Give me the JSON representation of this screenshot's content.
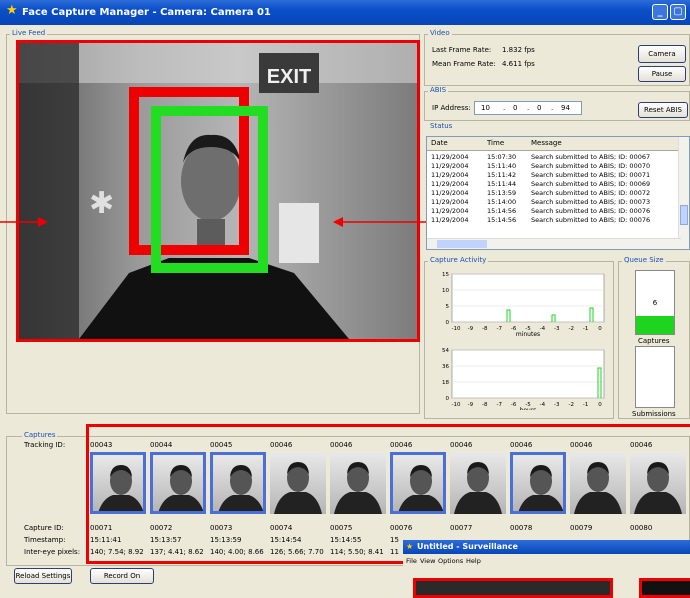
{
  "window": {
    "title": "Face Capture Manager - Camera: Camera 01"
  },
  "live_feed": {
    "legend": "Live Feed",
    "exit_sign": "EXIT"
  },
  "video": {
    "legend": "Video",
    "last_frame_rate_label": "Last Frame Rate:",
    "last_frame_rate_value": "1.832 fps",
    "mean_frame_rate_label": "Mean Frame Rate:",
    "mean_frame_rate_value": "4.611 fps",
    "camera_button": "Camera",
    "pause_button": "Pause"
  },
  "abis": {
    "legend": "ABIS",
    "ip_label": "IP Address:",
    "ip_octets": [
      "10",
      "0",
      "0",
      "94"
    ],
    "reset_button": "Reset ABIS"
  },
  "status": {
    "legend": "Status",
    "columns": [
      "Date",
      "Time",
      "Message"
    ],
    "rows": [
      [
        "11/29/2004",
        "15:07:30",
        "Search submitted to ABIS; ID: 00067"
      ],
      [
        "11/29/2004",
        "15:11:40",
        "Search submitted to ABIS; ID: 00070"
      ],
      [
        "11/29/2004",
        "15:11:42",
        "Search submitted to ABIS; ID: 00071"
      ],
      [
        "11/29/2004",
        "15:11:44",
        "Search submitted to ABIS; ID: 00069"
      ],
      [
        "11/29/2004",
        "15:13:59",
        "Search submitted to ABIS; ID: 00072"
      ],
      [
        "11/29/2004",
        "15:14:00",
        "Search submitted to ABIS; ID: 00073"
      ],
      [
        "11/29/2004",
        "15:14:56",
        "Search submitted to ABIS; ID: 00076"
      ],
      [
        "11/29/2004",
        "15:14:56",
        "Search submitted to ABIS; ID: 00076"
      ]
    ]
  },
  "capture_activity": {
    "legend": "Capture Activity",
    "minutes_chart": {
      "y_ticks": [
        "15",
        "10",
        "5",
        "0"
      ],
      "x_ticks": [
        "-10",
        "-9",
        "-8",
        "-7",
        "-6",
        "-5",
        "-4",
        "-3",
        "-2",
        "-1",
        "0"
      ],
      "xlabel": "minutes"
    },
    "hours_chart": {
      "y_ticks": [
        "54",
        "36",
        "18",
        "0"
      ],
      "x_ticks": [
        "-10",
        "-9",
        "-8",
        "-7",
        "-6",
        "-5",
        "-4",
        "-3",
        "-2",
        "-1",
        "0"
      ],
      "xlabel": "hours"
    }
  },
  "queue_size": {
    "legend": "Queue Size",
    "captures_value": "6",
    "captures_label": "Captures",
    "submissions_label": "Submissions",
    "captures_fill_fraction": 0.28
  },
  "captures": {
    "legend": "Captures",
    "tracking_label": "Tracking ID:",
    "capture_id_label": "Capture ID:",
    "timestamp_label": "Timestamp:",
    "intereye_label": "Inter-eye pixels:",
    "items": [
      {
        "tracking": "00043",
        "capture": "00071",
        "timestamp": "15:11:41",
        "intereye": "140; 7.54; 8.92",
        "selected": true
      },
      {
        "tracking": "00044",
        "capture": "00072",
        "timestamp": "15:13:57",
        "intereye": "137; 4.41; 8.62",
        "selected": true
      },
      {
        "tracking": "00045",
        "capture": "00073",
        "timestamp": "15:13:59",
        "intereye": "140; 4.00; 8.66",
        "selected": true
      },
      {
        "tracking": "00046",
        "capture": "00074",
        "timestamp": "15:14:54",
        "intereye": "126; 5.66; 7.70",
        "selected": false
      },
      {
        "tracking": "00046",
        "capture": "00075",
        "timestamp": "15:14:55",
        "intereye": "114; 5.50; 8.41",
        "selected": false
      },
      {
        "tracking": "00046",
        "capture": "00076",
        "timestamp": "15",
        "intereye": "11",
        "selected": true
      },
      {
        "tracking": "00046",
        "capture": "00077",
        "timestamp": "",
        "intereye": "",
        "selected": false
      },
      {
        "tracking": "00046",
        "capture": "00078",
        "timestamp": "",
        "intereye": "",
        "selected": true
      },
      {
        "tracking": "00046",
        "capture": "00079",
        "timestamp": "",
        "intereye": "",
        "selected": false
      },
      {
        "tracking": "00046",
        "capture": "00080",
        "timestamp": "",
        "intereye": "",
        "selected": false
      }
    ]
  },
  "buttons": {
    "reload": "Reload Settings",
    "record": "Record On"
  },
  "surveillance": {
    "title": "Untitled - Surveillance",
    "menu": [
      "File",
      "View",
      "Options",
      "Help"
    ]
  },
  "colors": {
    "highlight_red": "#e00000",
    "highlight_green": "#22dd22",
    "selection_blue": "#4a6fd6",
    "title_blue": "#0a4ec9"
  }
}
